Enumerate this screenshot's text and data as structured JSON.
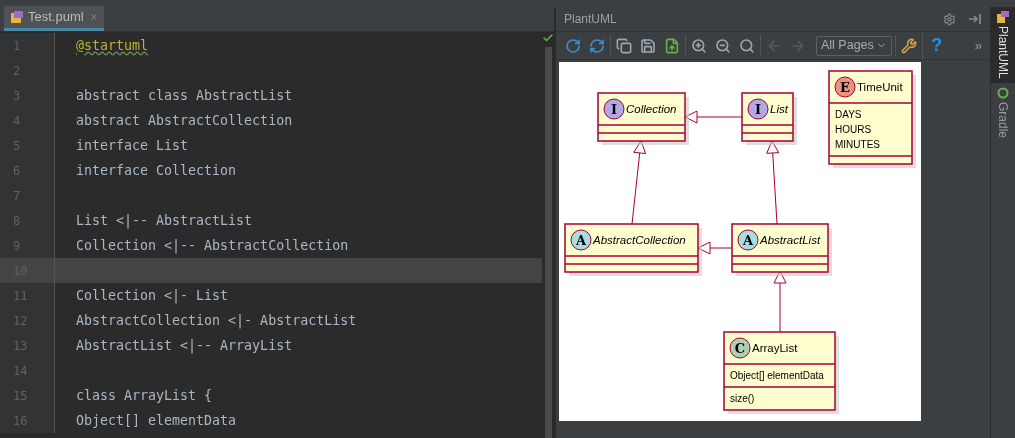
{
  "editor": {
    "tab": {
      "label": "Test.puml",
      "close": "×",
      "selected": true
    },
    "lines": [
      {
        "number": "1",
        "text": "@startuml",
        "kind": "annotation",
        "current": false
      },
      {
        "number": "2",
        "current": false
      },
      {
        "number": "3",
        "text": "abstract class AbstractList",
        "kind": "code",
        "current": false
      },
      {
        "number": "4",
        "text": "abstract AbstractCollection",
        "kind": "code",
        "current": false
      },
      {
        "number": "5",
        "text": "interface List",
        "kind": "code",
        "current": false
      },
      {
        "number": "6",
        "text": "interface Collection",
        "kind": "code",
        "current": false
      },
      {
        "number": "7",
        "current": false
      },
      {
        "number": "8",
        "text": "List <|-- AbstractList",
        "kind": "code",
        "current": false
      },
      {
        "number": "9",
        "text": "Collection <|-- AbstractCollection",
        "kind": "code",
        "current": false
      },
      {
        "number": "10",
        "current": true
      },
      {
        "number": "11",
        "text": "Collection <|- List",
        "kind": "code",
        "current": false
      },
      {
        "number": "12",
        "text": "AbstractCollection <|- AbstractList",
        "kind": "code",
        "current": false
      },
      {
        "number": "13",
        "text": "AbstractList <|-- ArrayList",
        "kind": "code",
        "current": false
      },
      {
        "number": "14",
        "current": false
      },
      {
        "number": "15",
        "text": "class ArrayList {",
        "kind": "code",
        "current": false
      },
      {
        "number": "16",
        "text": "Object[] elementData",
        "kind": "code",
        "current": false
      }
    ]
  },
  "panel": {
    "title": "PlantUML",
    "toolbar": {
      "groups": [
        {
          "items": [
            {
              "kind": "refresh",
              "disabled": false
            },
            {
              "kind": "sync",
              "disabled": false
            }
          ]
        },
        {
          "items": [
            {
              "kind": "copy",
              "disabled": false
            },
            {
              "kind": "save",
              "disabled": false
            },
            {
              "kind": "export",
              "disabled": false
            }
          ]
        },
        {
          "items": [
            {
              "kind": "zoom-in",
              "disabled": false
            },
            {
              "kind": "zoom-out",
              "disabled": false
            },
            {
              "kind": "actual-size",
              "disabled": false
            }
          ]
        },
        {
          "items": [
            {
              "kind": "back",
              "disabled": true
            },
            {
              "kind": "forward",
              "disabled": true
            },
            {
              "kind": "select",
              "label": "All Pages",
              "disabled": false
            }
          ]
        },
        {
          "items": [
            {
              "kind": "settings",
              "disabled": false
            }
          ]
        },
        {
          "items": [
            {
              "kind": "help",
              "label": "?",
              "disabled": false
            }
          ]
        }
      ],
      "more": "»"
    },
    "diagram": {
      "nodes": [
        {
          "name": "Collection",
          "kind": "interface",
          "letter": "I"
        },
        {
          "name": "List",
          "kind": "interface",
          "letter": "I"
        },
        {
          "name": "TimeUnit",
          "kind": "enum",
          "letter": "E",
          "fields": [
            "DAYS",
            "HOURS",
            "MINUTES"
          ]
        },
        {
          "name": "AbstractCollection",
          "kind": "abstract",
          "letter": "A"
        },
        {
          "name": "AbstractList",
          "kind": "abstract",
          "letter": "A"
        },
        {
          "name": "ArrayList",
          "kind": "class",
          "letter": "C",
          "fields": [
            "Object[] elementData"
          ],
          "methods": [
            "size()"
          ]
        }
      ]
    }
  },
  "sidebar": {
    "items": [
      {
        "label": "PlantUML",
        "selected": true
      },
      {
        "label": "Gradle",
        "selected": false
      }
    ]
  }
}
